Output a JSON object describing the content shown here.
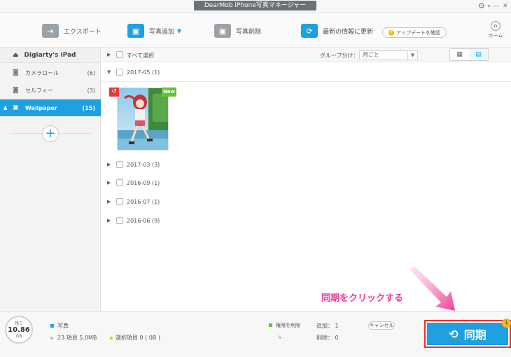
{
  "window": {
    "title": "DearMob iPhone写真マネージャー",
    "settings_icon": "⚙",
    "minimize_icon": "—",
    "close_icon": "✕"
  },
  "toolbar": {
    "export_label": "エクスポート",
    "add_photo_label": "写真追加",
    "delete_photo_label": "写真削除",
    "refresh_label": "最新の情報に更新",
    "update_label": "アップデートを確認",
    "home_label": "ホーム"
  },
  "sidebar": {
    "device_name": "Digiarty's iPad",
    "albums": [
      {
        "label": "カメラロール",
        "count": "(6)"
      },
      {
        "label": "セルフィー",
        "count": "(3)"
      },
      {
        "label": "Wallpaper",
        "count": "(15)"
      }
    ],
    "add_album": "+"
  },
  "main": {
    "select_all": "すべて選択",
    "group_by_label": "グループ分け：",
    "group_by_value": "月ごと",
    "groups": [
      {
        "label": "2017-05 (1)"
      },
      {
        "label": "2017-03 (3)"
      },
      {
        "label": "2016-09 (1)"
      },
      {
        "label": "2016-07 (1)"
      },
      {
        "label": "2016-06 (9)"
      }
    ],
    "new_badge": "New",
    "callout": "同期をクリックする"
  },
  "bottom": {
    "storage_label": "残り",
    "storage_value": "10.86",
    "storage_unit": "GB",
    "photos_label": "写真",
    "items_text": "23 項目 5.0MB",
    "selected_text": "選択項目 0 ( 0B )",
    "permission_delete": "権限を削除",
    "added_text": "追加： 1",
    "deleted_text": "削除： 0",
    "cancel_label": "キャンセル",
    "sync_label": "同期",
    "sync_badge": "1"
  },
  "colors": {
    "accent": "#1fa0e0",
    "callout": "#ee3e94",
    "sync_border": "#e8332c",
    "new_badge": "#62c23a"
  }
}
